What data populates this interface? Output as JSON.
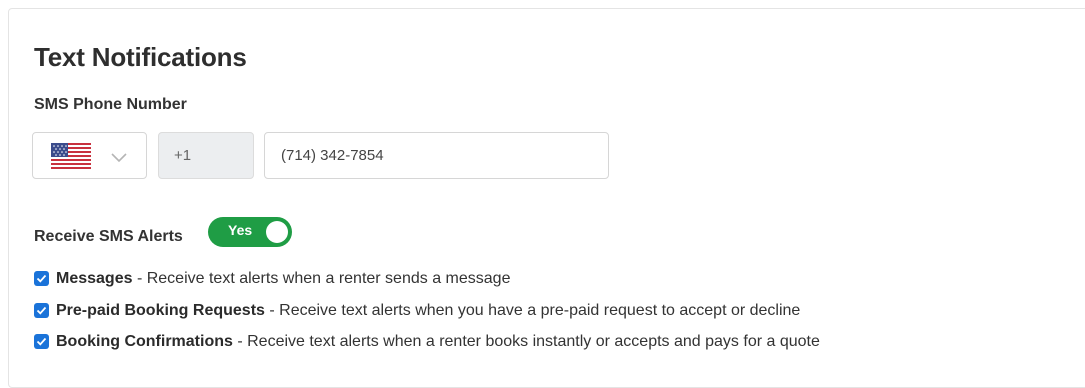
{
  "section": {
    "title": "Text Notifications",
    "phone_label": "SMS Phone Number",
    "country": {
      "flag_icon": "us-flag-icon",
      "dial_code": "+1"
    },
    "phone_value": "(714) 342-7854",
    "alerts_label": "Receive SMS Alerts",
    "toggle": {
      "label": "Yes",
      "on": true,
      "color": "#1f9d45"
    },
    "options": [
      {
        "title": "Messages",
        "separator": " - ",
        "description": "Receive text alerts when a renter sends a message",
        "checked": true
      },
      {
        "title": "Pre-paid Booking Requests",
        "separator": " - ",
        "description": "Receive text alerts when you have a pre-paid request to accept or decline",
        "checked": true
      },
      {
        "title": "Booking Confirmations",
        "separator": " - ",
        "description": "Receive text alerts when a renter books instantly or accepts and pays for a quote",
        "checked": true
      }
    ],
    "checkbox_color": "#1a73d9"
  }
}
